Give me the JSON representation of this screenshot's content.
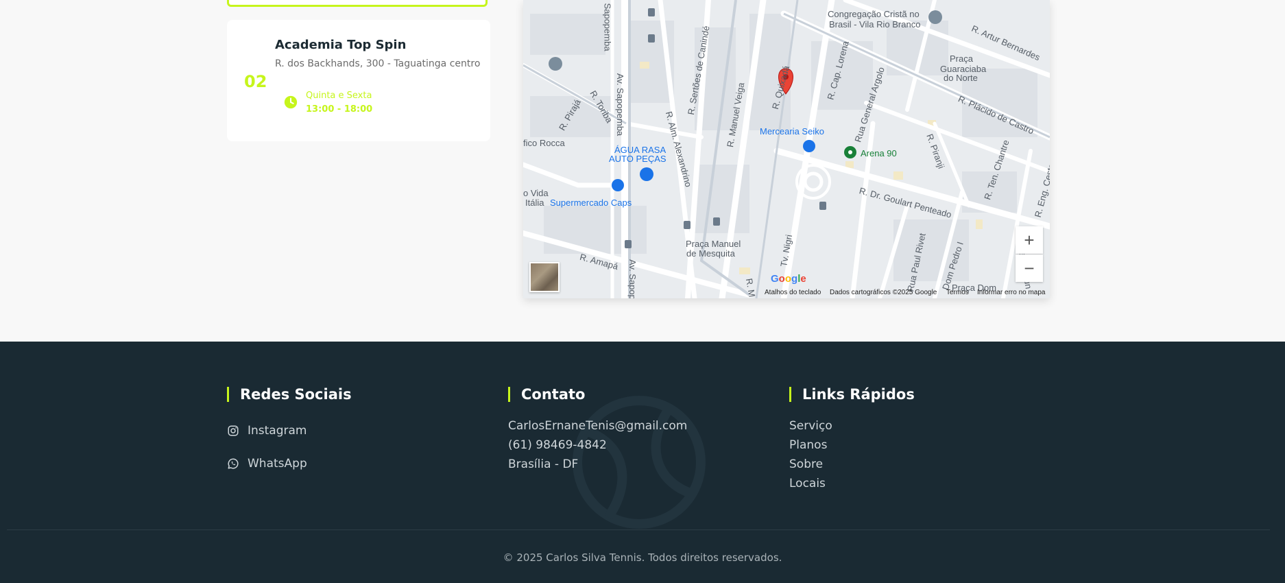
{
  "location": {
    "number": "02",
    "name": "Academia Top Spin",
    "address": "R. dos Backhands, 300 - Taguatinga centro",
    "days": "Quinta e Sexta",
    "hours": "13:00 - 18:00"
  },
  "map": {
    "labels": {
      "congregacao": "Congregação Cristã no",
      "congregacao2": "Brasil - Vila Rio Branco",
      "artur": "R. Artur Bernardes",
      "praca_guara1": "Praça",
      "praca_guara2": "Guaraciaba",
      "praca_guara3": "do Norte",
      "placido": "R. Plácido de Castro",
      "sapopemba": "Sapopemba",
      "av_sapopemba": "Av. Sapopemba",
      "canindé": "R. Sertões de Canindé",
      "quixada": "R. Quixadá",
      "cap_lorena": "R. Cap. Lorena",
      "gen_argolo": "Rua General Argolo",
      "piraja": "R. Pirajá",
      "toriba": "R. Toriba",
      "alm": "R. Alm. Alexandrino",
      "manuel_veiga": "R. Manuel Veiga",
      "mercearia": "Mercearia Seiko",
      "arena": "Arena 90",
      "piranji": "R. Piranji",
      "chantre": "R. Ten. Chantre",
      "eng": "R. Eng. Cesta",
      "rocca": "fico Rocca",
      "agua_rasa1": "ÁGUA RASA",
      "agua_rasa2": "AUTO PEÇAS",
      "vida": "o Vida",
      "italia": "Itália",
      "supermercado": "Supermercado Caps",
      "goulart": "R. Dr. Goulart Penteado",
      "praca_manuel1": "Praça Manuel",
      "praca_manuel2": "de Mesquita",
      "amapa": "R. Amapá",
      "av_sapop": "Av. Sapop",
      "tv_nigri": "Tv. Nigri",
      "paul": "Rua Paul Rivet",
      "dom_pedro": "Dom Pedro I",
      "raimund": "Rua Raimun",
      "praca_dom": "Praça Dom",
      "rm": "R. M"
    },
    "zoom_in": "+",
    "zoom_out": "−",
    "google_logo": "Google",
    "attribution": {
      "shortcuts": "Atalhos do teclado",
      "data": "Dados cartográficos ©2025 Google",
      "terms": "Termos",
      "report": "Informar erro no mapa"
    }
  },
  "footer": {
    "social_title": "Redes Sociais",
    "social": [
      {
        "label": "Instagram",
        "icon": "instagram-icon"
      },
      {
        "label": "WhatsApp",
        "icon": "whatsapp-icon"
      }
    ],
    "contact_title": "Contato",
    "contact": [
      "CarlosErnaneTenis@gmail.com",
      "(61) 98469-4842",
      "Brasília - DF"
    ],
    "links_title": "Links Rápidos",
    "links": [
      "Serviço",
      "Planos",
      "Sobre",
      "Locais"
    ],
    "copyright": "© 2025 Carlos Silva Tennis. Todos direitos reservados."
  },
  "colors": {
    "accent": "#c6f51c",
    "footer_bg": "#1a2a33"
  }
}
